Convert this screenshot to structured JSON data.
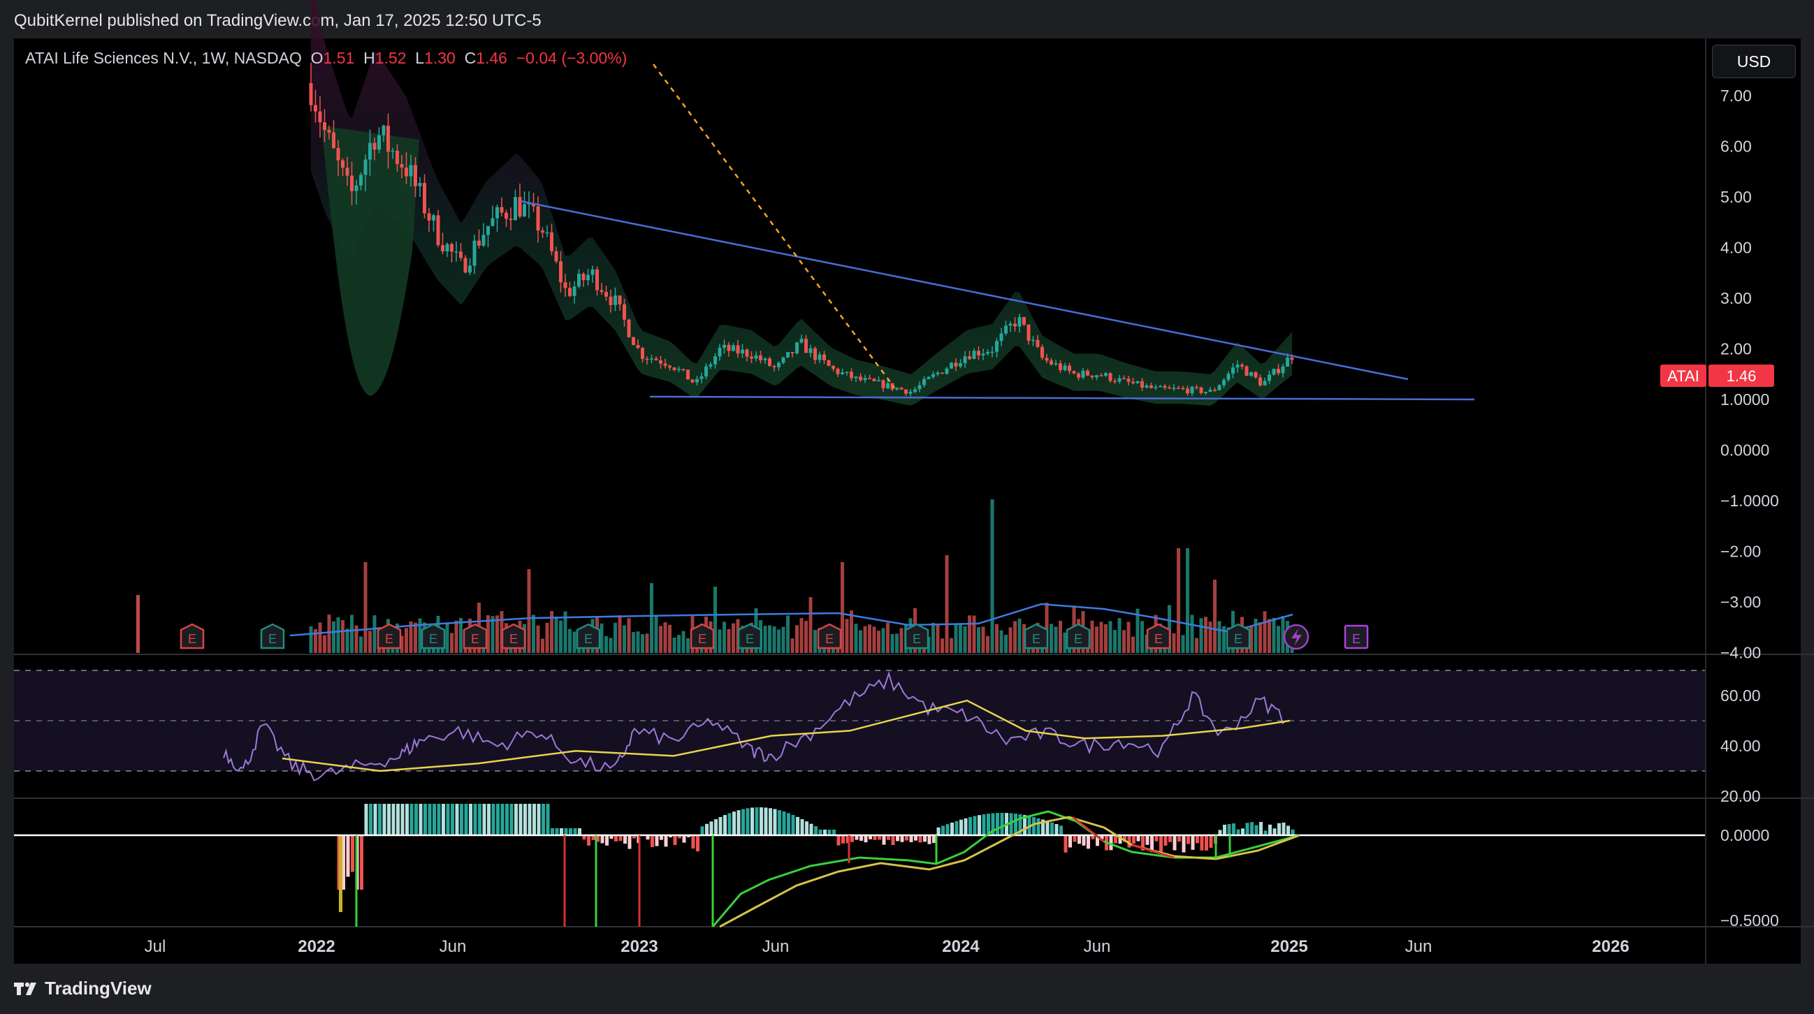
{
  "header": {
    "published": "QubitKernel published on TradingView.com, Jan 17, 2025 12:50 UTC-5"
  },
  "footer": {
    "brand": "TradingView"
  },
  "symbol": {
    "name": "ATAI Life Sciences N.V., 1W, NASDAQ",
    "o_label": "O",
    "o": "1.51",
    "h_label": "H",
    "h": "1.52",
    "l_label": "L",
    "l": "1.30",
    "c_label": "C",
    "c": "1.46",
    "change": "−0.04 (−3.00%)",
    "ticker": "ATAI",
    "last": "1.46"
  },
  "currency": "USD",
  "colors": {
    "up": "#26a69a",
    "down": "#ef5350",
    "rsi": "#9c7ad8",
    "rsi_ma": "#e8d44d",
    "trend": "#4a6cd4",
    "vol_ma": "#3c7ce0",
    "macd": "#3ad13a",
    "signal": "#d7c24a"
  },
  "chart_data": [
    {
      "type": "candlestick",
      "title": "ATAI Life Sciences N.V., 1W, NASDAQ",
      "x_ticks": [
        "Jul",
        "2022",
        "Jun",
        "2023",
        "Jun",
        "2024",
        "Jun",
        "2025",
        "Jun",
        "2026"
      ],
      "y_ticks": [
        "7.00",
        "6.00",
        "5.00",
        "4.00",
        "3.00",
        "2.00",
        "1.0000",
        "0.0000",
        "−1.0000",
        "−2.00",
        "−3.00",
        "−4.00"
      ],
      "ylim": [
        -4,
        7.5
      ],
      "close_path": [
        [
          "2021-12-20",
          7.5
        ],
        [
          "2022-01-10",
          6.2
        ],
        [
          "2022-02-07",
          5.0
        ],
        [
          "2022-03-07",
          6.3
        ],
        [
          "2022-04-11",
          5.6
        ],
        [
          "2022-05-16",
          4.3
        ],
        [
          "2022-06-13",
          3.6
        ],
        [
          "2022-07-11",
          4.4
        ],
        [
          "2022-08-15",
          4.9
        ],
        [
          "2022-09-12",
          4.4
        ],
        [
          "2022-10-10",
          3.1
        ],
        [
          "2022-11-07",
          3.5
        ],
        [
          "2022-12-05",
          2.9
        ],
        [
          "2023-01-02",
          1.9
        ],
        [
          "2023-02-06",
          1.7
        ],
        [
          "2023-03-06",
          1.3
        ],
        [
          "2023-04-03",
          2.0
        ],
        [
          "2023-05-08",
          1.9
        ],
        [
          "2023-06-05",
          1.6
        ],
        [
          "2023-07-03",
          2.1
        ],
        [
          "2023-08-07",
          1.6
        ],
        [
          "2023-09-04",
          1.4
        ],
        [
          "2023-10-02",
          1.3
        ],
        [
          "2023-11-06",
          1.15
        ],
        [
          "2023-12-04",
          1.5
        ],
        [
          "2024-01-08",
          1.9
        ],
        [
          "2024-02-05",
          2.0
        ],
        [
          "2024-03-04",
          2.6
        ],
        [
          "2024-04-01",
          1.8
        ],
        [
          "2024-05-06",
          1.5
        ],
        [
          "2024-06-03",
          1.5
        ],
        [
          "2024-07-01",
          1.35
        ],
        [
          "2024-08-05",
          1.2
        ],
        [
          "2024-09-02",
          1.2
        ],
        [
          "2024-10-07",
          1.15
        ],
        [
          "2024-11-04",
          1.7
        ],
        [
          "2024-12-02",
          1.3
        ],
        [
          "2025-01-06",
          1.9
        ],
        [
          "2025-01-13",
          1.46
        ]
      ],
      "annotations": [
        "descending trendline from ~4.9 (Sep 2022) to ~1.4 (Jul 2025)",
        "horizontal support at ~1.0",
        "dashed orange line from top to ~1.1 (Oct 2023)"
      ]
    },
    {
      "type": "line",
      "name": "RSI",
      "y_ticks": [
        "60.00",
        "40.00",
        "20.00"
      ],
      "ylim": [
        18,
        72
      ],
      "levels": [
        70,
        50,
        30
      ],
      "rsi": [
        [
          0,
          38
        ],
        [
          0.1,
          30
        ],
        [
          0.2,
          48
        ],
        [
          0.35,
          32
        ],
        [
          0.5,
          28
        ],
        [
          0.7,
          32
        ],
        [
          0.9,
          36
        ],
        [
          1.0,
          42
        ],
        [
          1.2,
          46
        ],
        [
          1.4,
          40
        ],
        [
          1.6,
          46
        ],
        [
          1.8,
          34
        ],
        [
          2.0,
          30
        ],
        [
          2.1,
          46
        ],
        [
          2.3,
          42
        ],
        [
          2.5,
          50
        ],
        [
          2.7,
          38
        ],
        [
          2.8,
          36
        ],
        [
          3.0,
          45
        ],
        [
          3.2,
          58
        ],
        [
          3.4,
          66
        ],
        [
          3.6,
          55
        ],
        [
          3.8,
          52
        ],
        [
          4.0,
          42
        ],
        [
          4.2,
          45
        ],
        [
          4.4,
          40
        ],
        [
          4.6,
          42
        ],
        [
          4.8,
          38
        ],
        [
          4.95,
          60
        ],
        [
          5.1,
          44
        ],
        [
          5.3,
          58
        ],
        [
          5.45,
          50
        ]
      ],
      "rsi_ma": [
        [
          0.3,
          35
        ],
        [
          0.8,
          30
        ],
        [
          1.3,
          33
        ],
        [
          1.8,
          38
        ],
        [
          2.3,
          36
        ],
        [
          2.8,
          44
        ],
        [
          3.2,
          46
        ],
        [
          3.5,
          52
        ],
        [
          3.8,
          58
        ],
        [
          4.1,
          46
        ],
        [
          4.4,
          43
        ],
        [
          4.8,
          44
        ],
        [
          5.2,
          47
        ],
        [
          5.45,
          50
        ]
      ]
    },
    {
      "type": "bar",
      "name": "MACD histogram",
      "y_ticks": [
        "0.0000",
        "−0.5000"
      ],
      "ylim": [
        -0.55,
        0.2
      ]
    }
  ]
}
